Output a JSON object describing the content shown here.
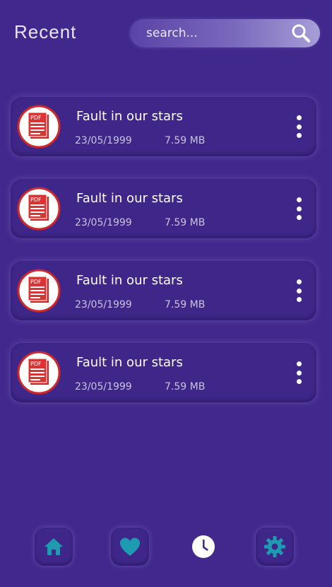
{
  "header": {
    "title": "Recent",
    "search_placeholder": "search..."
  },
  "files": [
    {
      "name": "Fault in our stars",
      "date": "23/05/1999",
      "size": "7.59 MB",
      "icon": "pdf-icon"
    },
    {
      "name": "Fault in our stars",
      "date": "23/05/1999",
      "size": "7.59 MB",
      "icon": "pdf-icon"
    },
    {
      "name": "Fault in our stars",
      "date": "23/05/1999",
      "size": "7.59 MB",
      "icon": "pdf-icon"
    },
    {
      "name": "Fault in our stars",
      "date": "23/05/1999",
      "size": "7.59 MB",
      "icon": "pdf-icon"
    }
  ],
  "nav": {
    "items": [
      {
        "icon": "home-icon",
        "active": false
      },
      {
        "icon": "heart-icon",
        "active": false
      },
      {
        "icon": "clock-icon",
        "active": true
      },
      {
        "icon": "gear-icon",
        "active": false
      }
    ]
  },
  "colors": {
    "background": "#41288c",
    "nav_icon": "#1e9bb0",
    "active_icon": "#ffffff",
    "pdf_red": "#cc2a2a"
  }
}
